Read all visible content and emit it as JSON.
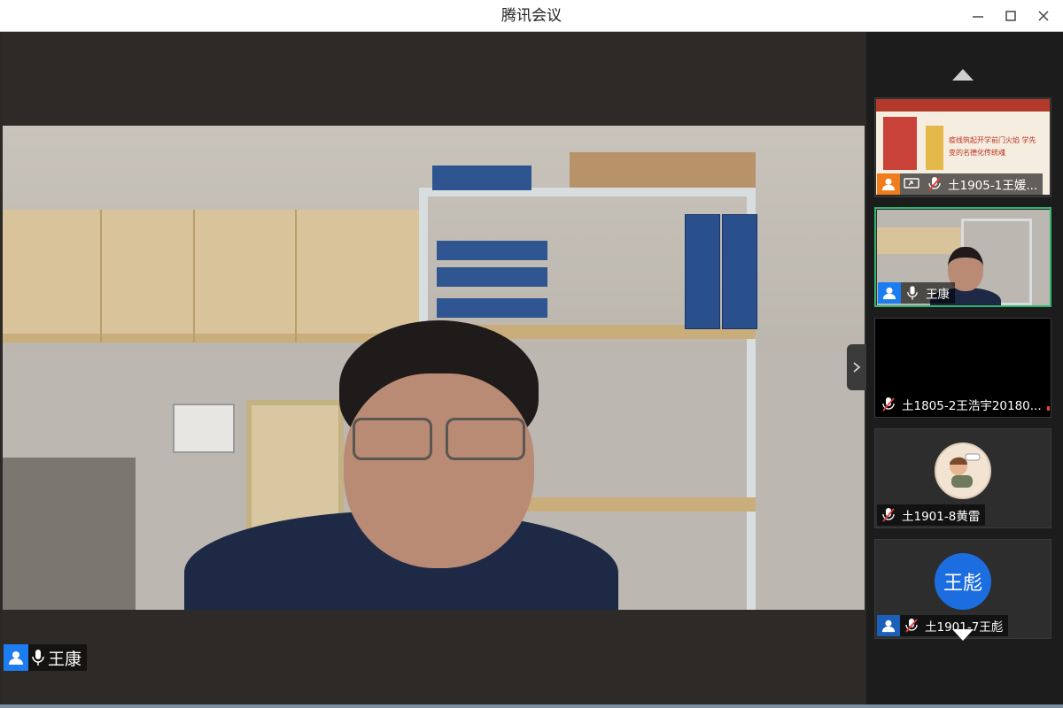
{
  "window": {
    "title": "腾讯会议"
  },
  "main_speaker": {
    "name": "王康"
  },
  "sidebar": {
    "tiles": [
      {
        "name": "土1905-1王媛...",
        "type": "screen-share",
        "mic": "muted",
        "active": false
      },
      {
        "name": "王康",
        "type": "video",
        "mic": "on",
        "active": true
      },
      {
        "name": "土1805-2王浩宇20180...",
        "type": "video-off",
        "mic": "muted",
        "active": false
      },
      {
        "name": "土1901-8黄雷",
        "type": "avatar-image",
        "mic": "muted",
        "active": false
      },
      {
        "name": "土1901-7王彪",
        "type": "avatar-text",
        "avatar_text": "王彪",
        "mic": "muted",
        "active": false
      }
    ]
  },
  "slide": {
    "title": "疫线筑起开学前门火焰 学先变的名德化传统魂"
  },
  "colors": {
    "accent_blue": "#1c7cf2",
    "active_border": "#2fb56f",
    "share_orange": "#f07d1b",
    "sidebar_bg": "#1c1c1c"
  },
  "icons": [
    "minimize-icon",
    "maximize-icon",
    "close-icon",
    "user-icon",
    "mic-icon",
    "mic-muted-icon",
    "screen-share-icon",
    "chevron-right-icon",
    "arrow-up-icon",
    "arrow-down-icon",
    "signal-icon"
  ]
}
